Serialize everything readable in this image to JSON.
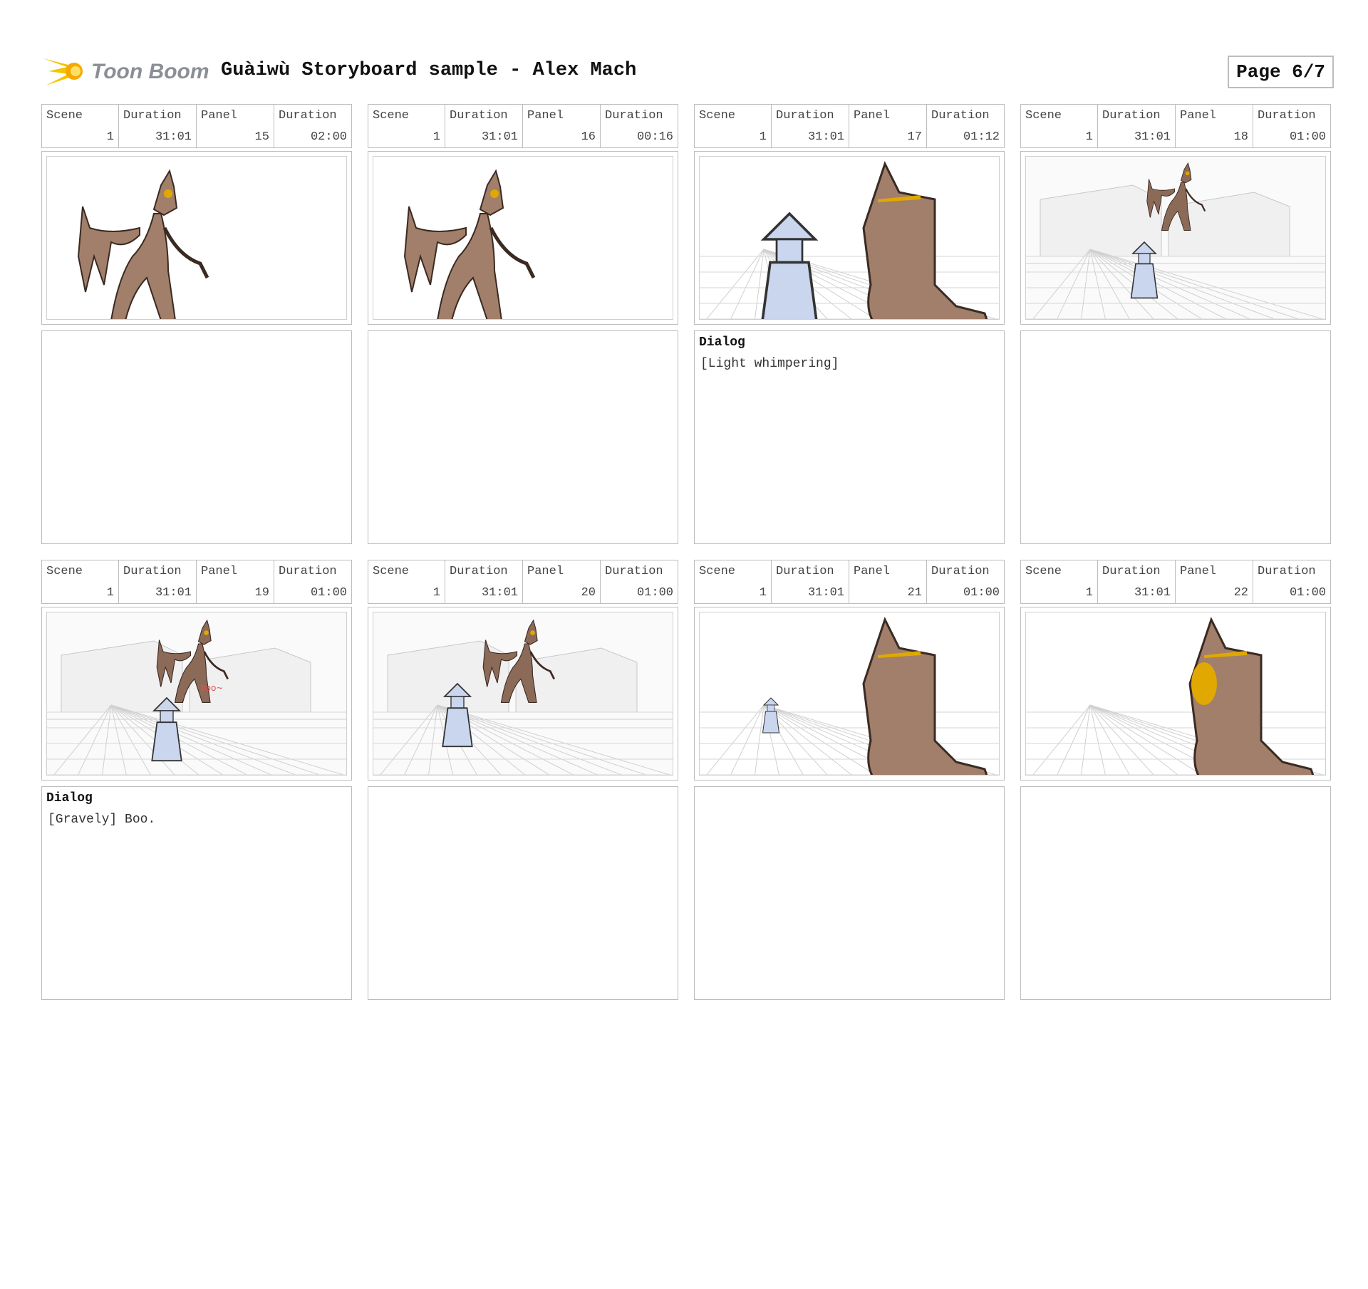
{
  "header": {
    "logo_text": "Toon Boom",
    "title": "Guàiwù Storyboard sample - Alex Mach",
    "page": "Page 6/7"
  },
  "labels": {
    "scene": "Scene",
    "duration": "Duration",
    "panel": "Panel"
  },
  "panels": [
    {
      "scene": "1",
      "scene_duration": "31:01",
      "panel": "15",
      "panel_duration": "02:00",
      "dialog_title": "",
      "dialog": "",
      "image": "creature-sparks"
    },
    {
      "scene": "1",
      "scene_duration": "31:01",
      "panel": "16",
      "panel_duration": "00:16",
      "dialog_title": "",
      "dialog": "",
      "image": "creature-startled"
    },
    {
      "scene": "1",
      "scene_duration": "31:01",
      "panel": "17",
      "panel_duration": "01:12",
      "dialog_title": "Dialog",
      "dialog": "[Light whimpering]",
      "image": "closeup-samurai"
    },
    {
      "scene": "1",
      "scene_duration": "31:01",
      "panel": "18",
      "panel_duration": "01:00",
      "dialog_title": "",
      "dialog": "",
      "image": "village-wide"
    },
    {
      "scene": "1",
      "scene_duration": "31:01",
      "panel": "19",
      "panel_duration": "01:00",
      "dialog_title": "Dialog",
      "dialog": "[Gravely] Boo.",
      "image": "village-boo"
    },
    {
      "scene": "1",
      "scene_duration": "31:01",
      "panel": "20",
      "panel_duration": "01:00",
      "dialog_title": "",
      "dialog": "",
      "image": "village-run"
    },
    {
      "scene": "1",
      "scene_duration": "31:01",
      "panel": "21",
      "panel_duration": "01:00",
      "dialog_title": "",
      "dialog": "",
      "image": "closeup-distant"
    },
    {
      "scene": "1",
      "scene_duration": "31:01",
      "panel": "22",
      "panel_duration": "01:00",
      "dialog_title": "",
      "dialog": "",
      "image": "closeup-gone"
    }
  ]
}
